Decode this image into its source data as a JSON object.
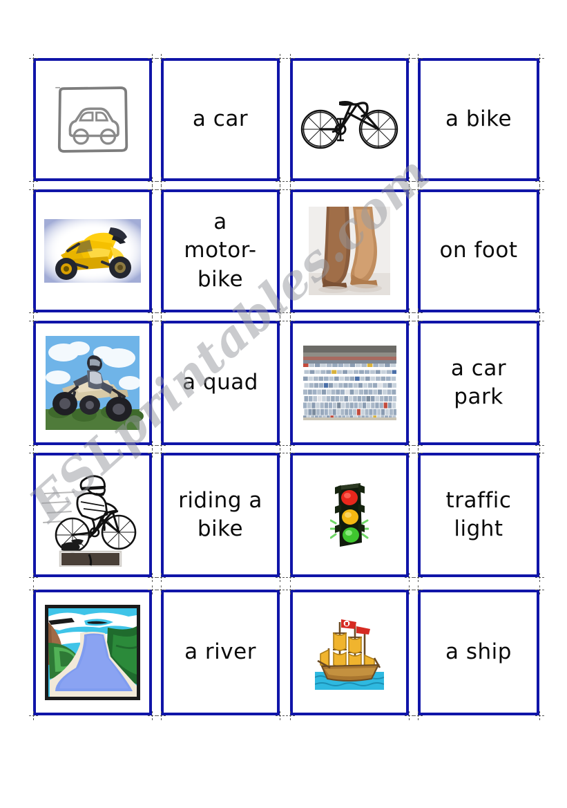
{
  "document": {
    "type": "esl-flashcard-worksheet",
    "title": "Transport vocabulary matching cards",
    "columns": 4,
    "rows": 5,
    "card_border_color": "#1015a8",
    "background_color": "#ffffff",
    "text_color": "#0a0a0a"
  },
  "watermark": {
    "text": "ESLprintables.com",
    "color": "#96989e",
    "rotation_deg": -42
  },
  "cards": [
    {
      "row": 1,
      "col": 1,
      "kind": "picture",
      "icon": "car-outline-icon",
      "label": "a car"
    },
    {
      "row": 1,
      "col": 2,
      "kind": "word",
      "icon": "",
      "label": "a car"
    },
    {
      "row": 1,
      "col": 3,
      "kind": "picture",
      "icon": "bicycle-icon",
      "label": "a bike"
    },
    {
      "row": 1,
      "col": 4,
      "kind": "word",
      "icon": "",
      "label": "a bike"
    },
    {
      "row": 2,
      "col": 1,
      "kind": "picture",
      "icon": "motorbike-icon",
      "label": "a motor-bike"
    },
    {
      "row": 2,
      "col": 2,
      "kind": "word",
      "icon": "",
      "label": "a\nmotor-\nbike"
    },
    {
      "row": 2,
      "col": 3,
      "kind": "picture",
      "icon": "bare-feet-icon",
      "label": "on foot"
    },
    {
      "row": 2,
      "col": 4,
      "kind": "word",
      "icon": "",
      "label": "on foot"
    },
    {
      "row": 3,
      "col": 1,
      "kind": "picture",
      "icon": "quad-bike-icon",
      "label": "a quad"
    },
    {
      "row": 3,
      "col": 2,
      "kind": "word",
      "icon": "",
      "label": "a quad"
    },
    {
      "row": 3,
      "col": 3,
      "kind": "picture",
      "icon": "car-park-icon",
      "label": "a car park"
    },
    {
      "row": 3,
      "col": 4,
      "kind": "word",
      "icon": "",
      "label": "a car\npark"
    },
    {
      "row": 4,
      "col": 1,
      "kind": "picture",
      "icon": "cyclist-riding-icon",
      "label": "riding a bike"
    },
    {
      "row": 4,
      "col": 2,
      "kind": "word",
      "icon": "",
      "label": "riding a\nbike"
    },
    {
      "row": 4,
      "col": 3,
      "kind": "picture",
      "icon": "traffic-light-icon",
      "label": "traffic light"
    },
    {
      "row": 4,
      "col": 4,
      "kind": "word",
      "icon": "",
      "label": "traffic\nlight"
    },
    {
      "row": 5,
      "col": 1,
      "kind": "picture",
      "icon": "river-landscape-icon",
      "label": "a river"
    },
    {
      "row": 5,
      "col": 2,
      "kind": "word",
      "icon": "",
      "label": "a river"
    },
    {
      "row": 5,
      "col": 3,
      "kind": "picture",
      "icon": "sailing-ship-icon",
      "label": "a ship"
    },
    {
      "row": 5,
      "col": 4,
      "kind": "word",
      "icon": "",
      "label": "a ship"
    }
  ]
}
